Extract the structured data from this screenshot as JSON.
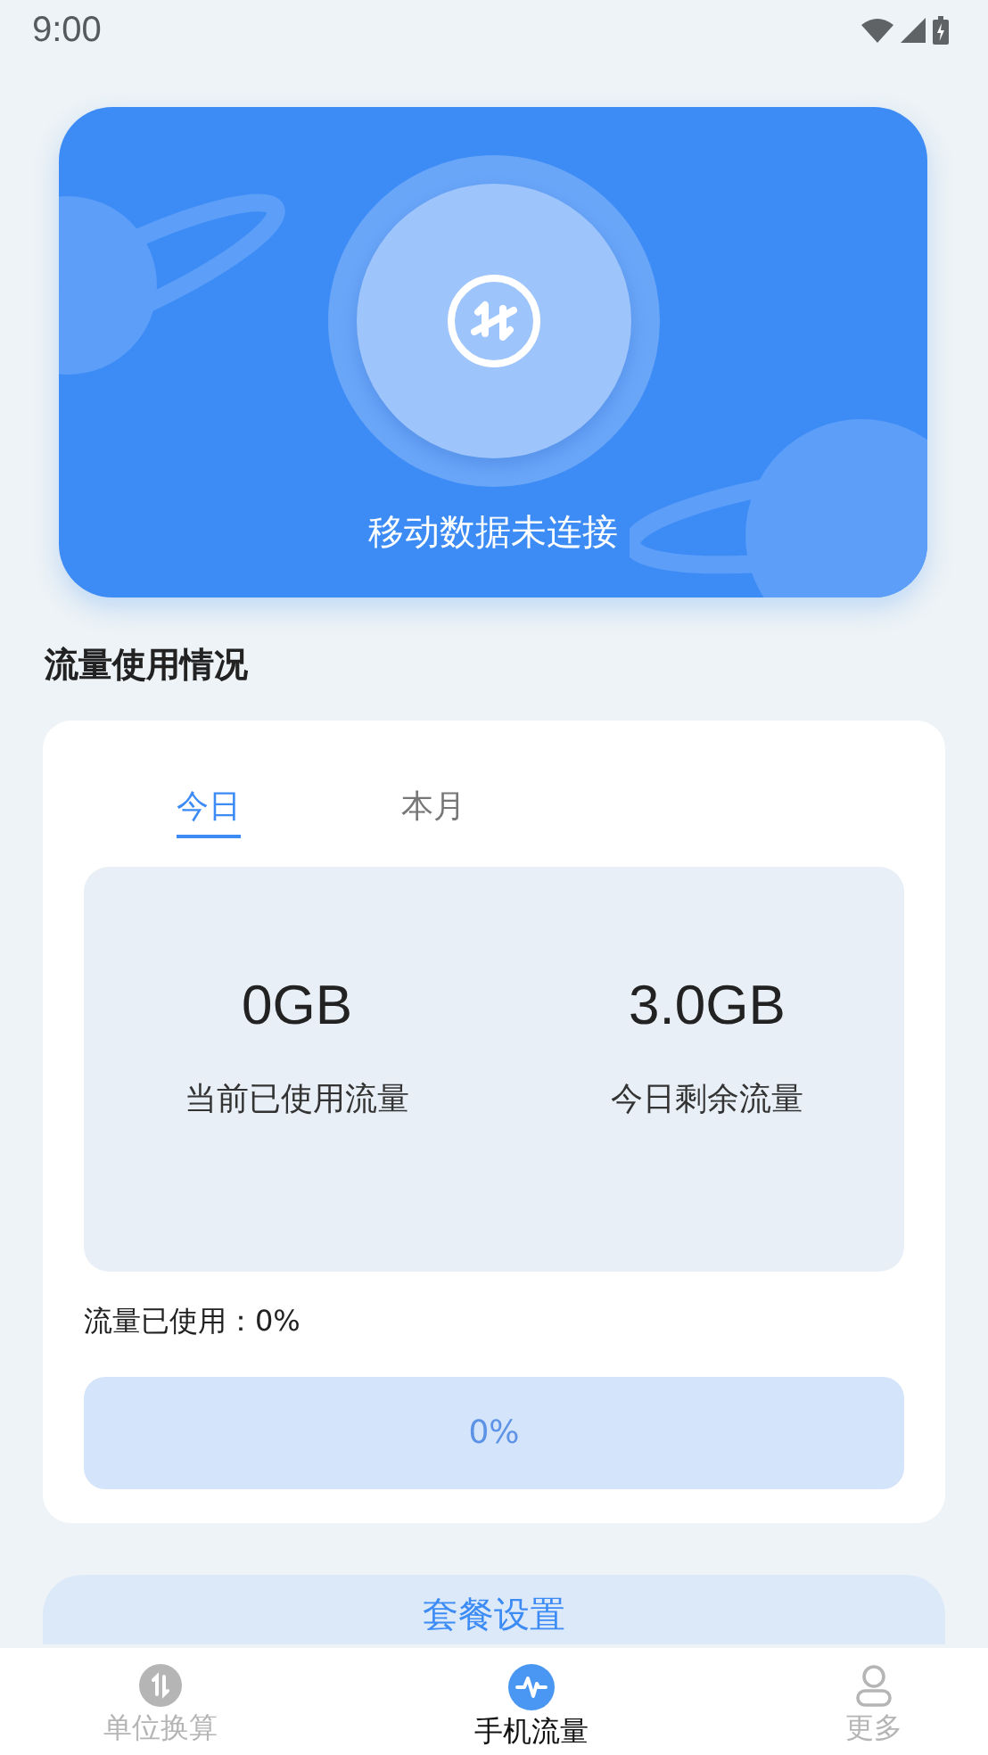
{
  "status_bar": {
    "time": "9:00"
  },
  "hero": {
    "status": "移动数据未连接"
  },
  "section_title": "流量使用情况",
  "tabs": [
    {
      "label": "今日",
      "selected": true
    },
    {
      "label": "本月",
      "selected": false
    }
  ],
  "stats": [
    {
      "value": "0GB",
      "label": "当前已使用流量"
    },
    {
      "value": "3.0GB",
      "label": "今日剩余流量"
    }
  ],
  "usage": {
    "label": "流量已使用：0%",
    "reading": "0%"
  },
  "package_button": "套餐设置",
  "nav": [
    {
      "label": "单位换算",
      "kind": "convert",
      "selected": false
    },
    {
      "label": "手机流量",
      "kind": "wave",
      "selected": true
    },
    {
      "label": "更多",
      "kind": "person",
      "selected": false
    }
  ]
}
